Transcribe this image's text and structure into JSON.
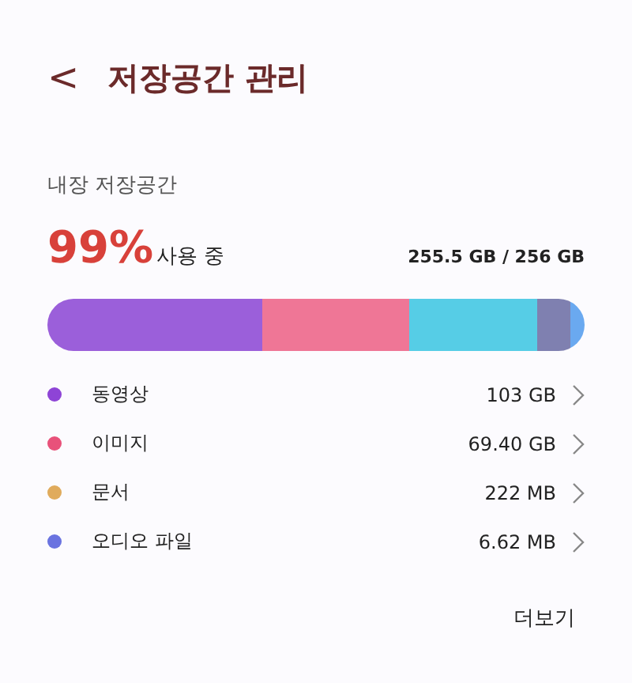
{
  "header": {
    "back": "<",
    "title": "저장공간 관리"
  },
  "storage": {
    "label": "내장 저장공간",
    "percent": "99%",
    "used_label": "사용 중",
    "amount": "255.5 GB / 256 GB"
  },
  "usage_bar": {
    "segments": [
      {
        "color": "#9b5fda"
      },
      {
        "color": "#ef7696"
      },
      {
        "color": "#56cde6"
      },
      {
        "color": "#7f80b0"
      },
      {
        "color": "#6aa9f0"
      }
    ]
  },
  "categories": [
    {
      "name": "동영상",
      "size": "103 GB",
      "color": "#8e44d6"
    },
    {
      "name": "이미지",
      "size": "69.40 GB",
      "color": "#e8517a"
    },
    {
      "name": "문서",
      "size": "222 MB",
      "color": "#e0ab5c"
    },
    {
      "name": "오디오 파일",
      "size": "6.62 MB",
      "color": "#6a73e0"
    }
  ],
  "more_button": "더보기"
}
